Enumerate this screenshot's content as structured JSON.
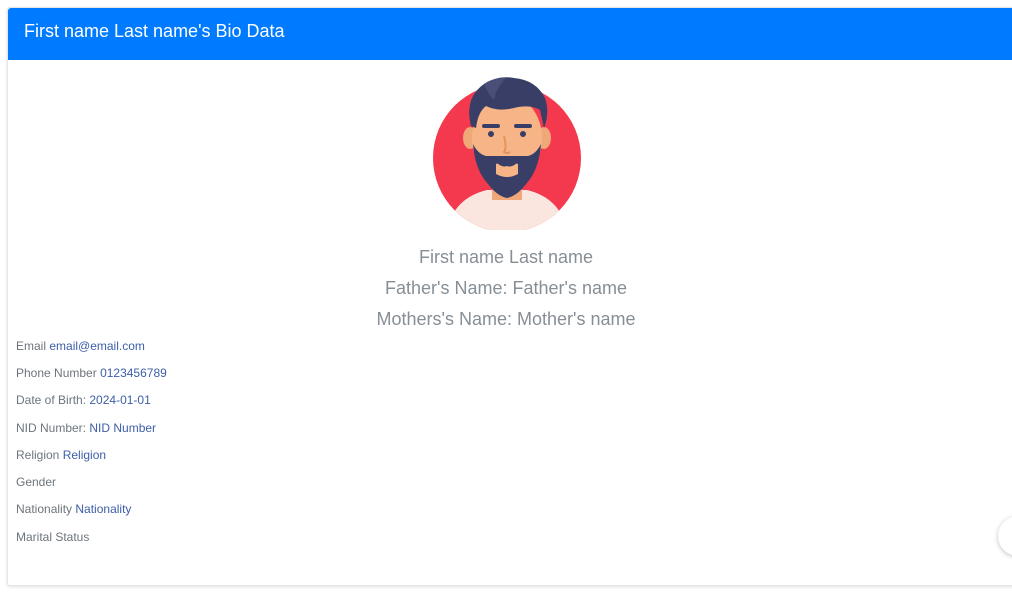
{
  "header": {
    "title": "First name Last name's Bio Data"
  },
  "profile": {
    "full_name": "First name Last name",
    "father": "Father's Name: Father's name",
    "mother": "Mothers's Name: Mother's name",
    "avatar_icon": "bearded-man-avatar-icon"
  },
  "details": [
    {
      "label": "Email",
      "value": "email@email.com"
    },
    {
      "label": "Phone Number",
      "value": "0123456789"
    },
    {
      "label": "Date of Birth:",
      "value": "2024-01-01"
    },
    {
      "label": "NID Number:",
      "value": "NID Number"
    },
    {
      "label": "Religion",
      "value": "Religion"
    },
    {
      "label": "Gender",
      "value": ""
    },
    {
      "label": "Nationality",
      "value": "Nationality"
    },
    {
      "label": "Marital Status",
      "value": ""
    }
  ],
  "colors": {
    "header_bg": "#007bff",
    "value_text": "#3d5ea8",
    "label_text": "#6c757d",
    "avatar_circle": "#f4394f"
  }
}
